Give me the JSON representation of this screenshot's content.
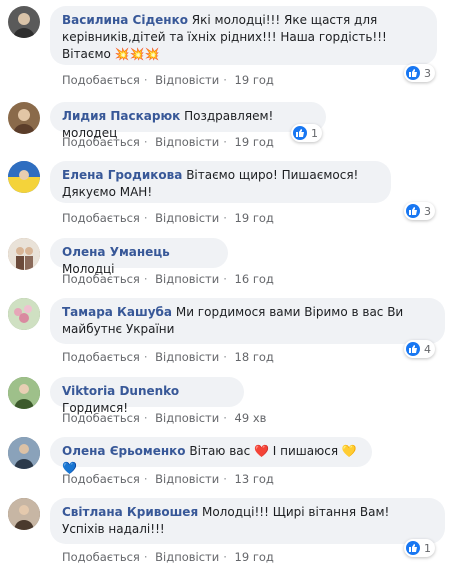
{
  "comments": [
    {
      "author": "Василина Сіденко",
      "text": "Які молодці!!! Яке щастя для керівників,дітей та їхніх рідних!!! Наша гордість!!! Вітаємо 💥💥💥",
      "like": "Подобається",
      "reply": "Відповісти",
      "time": "19 год",
      "reactions": "3",
      "avatar_color": "#5a5a5a"
    },
    {
      "author": "Лидия Паскарюк",
      "text": "Поздравляем! молодец",
      "like": "Подобається",
      "reply": "Відповісти",
      "time": "19 год",
      "reactions": "1",
      "avatar_color": "#8a6a4a"
    },
    {
      "author": "Елена Гродикова",
      "text": "Вітаємо щиро! Пишаємося! Дякуємо МАН!",
      "like": "Подобається",
      "reply": "Відповісти",
      "time": "19 год",
      "reactions": "3",
      "avatar_color": "#3b6fb5"
    },
    {
      "author": "Олена Уманець",
      "text": "Молодці",
      "like": "Подобається",
      "reply": "Відповісти",
      "time": "16 год",
      "reactions": "",
      "avatar_color": "#b48a6a"
    },
    {
      "author": "Тамара Кашуба",
      "text": "Ми гордимося вами Віримо в вас Ви майбутнє України",
      "like": "Подобається",
      "reply": "Відповісти",
      "time": "18 год",
      "reactions": "4",
      "avatar_color": "#7b9b6a"
    },
    {
      "author": "Viktoria Dunenko",
      "text": "Гордимся!",
      "like": "Подобається",
      "reply": "Відповісти",
      "time": "49 хв",
      "reactions": "",
      "avatar_color": "#4f7a3a"
    },
    {
      "author": "Олена Єрьоменко",
      "text": "Вітаю вас ❤️ І пишаюся 💛💙",
      "like": "Подобається",
      "reply": "Відповісти",
      "time": "13 год",
      "reactions": "",
      "avatar_color": "#5a6f86"
    },
    {
      "author": "Світлана Кривошея",
      "text": "Молодці!!! Щирі вітання Вам! Успіхів надалі!!!",
      "like": "Подобається",
      "reply": "Відповісти",
      "time": "19 год",
      "reactions": "1",
      "avatar_color": "#6d5a4a"
    }
  ],
  "colors": {
    "author": "#385898",
    "bubble": "#f0f2f5",
    "like_blue": "#1877f2",
    "meta": "#65676b"
  },
  "icons": {
    "reaction": "thumbs-up-icon"
  }
}
